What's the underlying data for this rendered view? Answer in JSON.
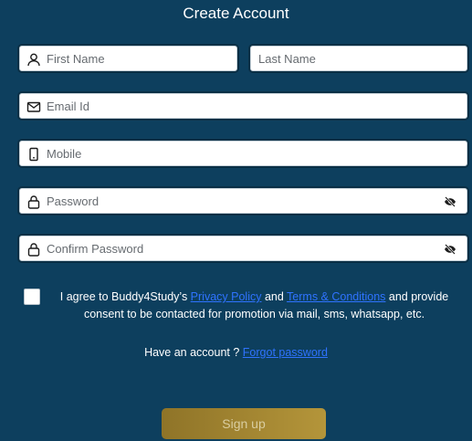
{
  "title": "Create Account",
  "fields": {
    "first_name": {
      "placeholder": "First Name",
      "icon": "user-icon"
    },
    "last_name": {
      "placeholder": "Last Name"
    },
    "email": {
      "placeholder": "Email Id",
      "icon": "mail-icon"
    },
    "mobile": {
      "placeholder": "Mobile",
      "icon": "mobile-icon"
    },
    "password": {
      "placeholder": "Password",
      "icon": "lock-icon",
      "toggle_icon": "eye-off-icon"
    },
    "confirm_password": {
      "placeholder": "Confirm Password",
      "icon": "lock-icon",
      "toggle_icon": "eye-off-icon"
    }
  },
  "agreement": {
    "checked": false,
    "prefix": "I agree to Buddy4Study’s ",
    "privacy_link": "Privacy Policy",
    "and": " and ",
    "terms_link": "Terms & Conditions",
    "suffix": " and provide consent to be contacted for promotion via mail, sms, whatsapp, etc."
  },
  "account": {
    "prompt": "Have an account ? ",
    "forgot_link": "Forgot password"
  },
  "signup_label": "Sign up",
  "colors": {
    "background": "#0d3f5e",
    "link": "#2f73ff",
    "button_gradient_start": "#8f7428",
    "button_gradient_end": "#b4953a"
  }
}
